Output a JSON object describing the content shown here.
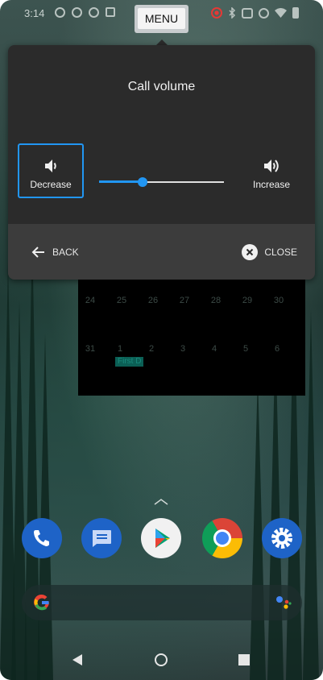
{
  "status_bar": {
    "time": "3:14",
    "menu_label": "MENU"
  },
  "volume_dialog": {
    "title": "Call volume",
    "decrease_label": "Decrease",
    "increase_label": "Increase",
    "slider_value_fraction": 0.35,
    "back_label": "BACK",
    "close_label": "CLOSE",
    "accent_color": "#2196f3"
  },
  "calendar": {
    "week1": [
      "24",
      "25",
      "26",
      "27",
      "28",
      "29",
      "30"
    ],
    "week2": [
      "31",
      "1",
      "2",
      "3",
      "4",
      "5",
      "6"
    ],
    "event_label": "First D"
  },
  "dock_apps": [
    "phone-icon",
    "messages-icon",
    "play-store-icon",
    "chrome-icon",
    "settings-icon"
  ],
  "nav_icons": [
    "back-triangle-icon",
    "home-circle-icon",
    "recents-square-icon"
  ]
}
